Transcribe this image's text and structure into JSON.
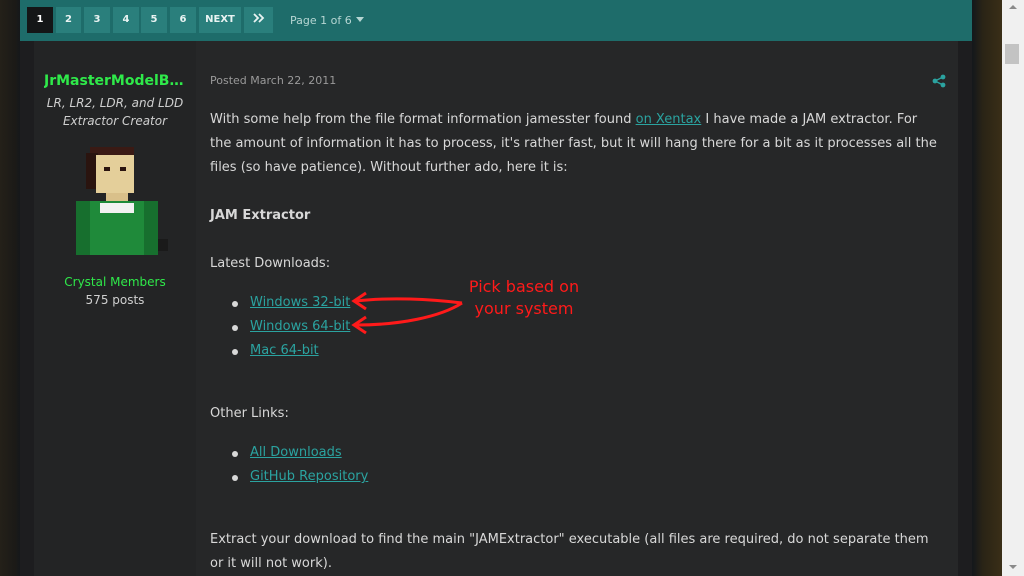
{
  "pagination": {
    "pages": [
      "1",
      "2",
      "3",
      "4",
      "5",
      "6"
    ],
    "next_label": "NEXT",
    "last_icon": "double-chevron-right-icon",
    "page_info": "Page 1 of 6"
  },
  "author": {
    "name": "JrMasterModelBuilder",
    "title_line1": "LR, LR2, LDR, and LDD",
    "title_line2": "Extractor Creator",
    "group": "Crystal Members",
    "post_count": "575 posts"
  },
  "post": {
    "posted": "Posted March 22, 2011",
    "intro_before_link": "With some help from the file format information jamesster found ",
    "intro_link": "on Xentax",
    "intro_after_link": " I have made a JAM extractor. For the amount of information it has to process, it's rather fast, but it will hang there for a bit as it processes all the files (so have patience). Without further ado, here it is:",
    "heading": "JAM Extractor",
    "latest_label": "Latest Downloads:",
    "downloads": [
      "Windows 32-bit",
      "Windows 64-bit",
      "Mac 64-bit"
    ],
    "other_label": "Other Links:",
    "other_links": [
      "All Downloads",
      "GitHub Repository"
    ],
    "footer_text": "Extract your download to find the main \"JAMExtractor\" executable (all files are required, do not separate them or it will not work)."
  },
  "annotation": {
    "line1": "Pick based on",
    "line2": "your system",
    "color": "#ff1a1a"
  },
  "colors": {
    "accent": "#1e6c6a",
    "author_green": "#2fe94a",
    "link": "#2ba3a0"
  }
}
